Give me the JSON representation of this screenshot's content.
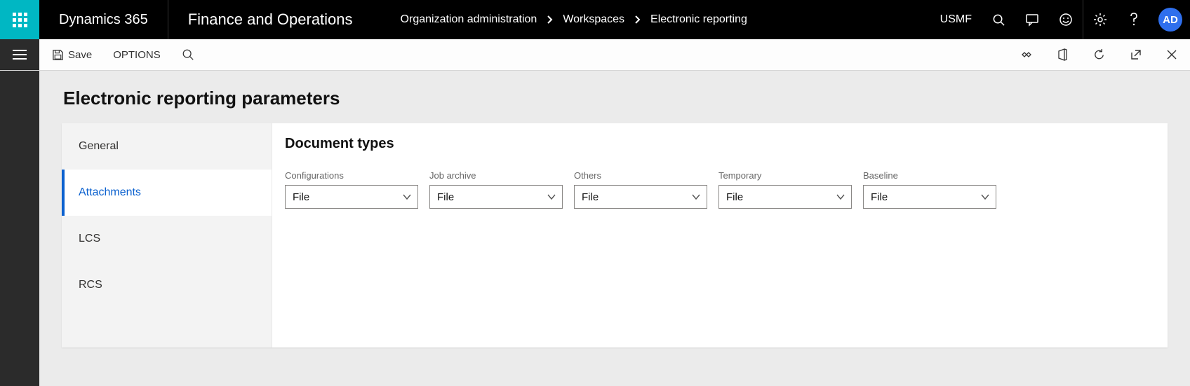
{
  "topbar": {
    "brand": "Dynamics 365",
    "module": "Finance and Operations",
    "company": "USMF",
    "avatar_initials": "AD"
  },
  "breadcrumbs": [
    "Organization administration",
    "Workspaces",
    "Electronic reporting"
  ],
  "actionbar": {
    "save_label": "Save",
    "options_label": "OPTIONS"
  },
  "page": {
    "title": "Electronic reporting parameters"
  },
  "tabs": [
    {
      "label": "General"
    },
    {
      "label": "Attachments"
    },
    {
      "label": "LCS"
    },
    {
      "label": "RCS"
    }
  ],
  "active_tab_index": 1,
  "section": {
    "title": "Document types",
    "fields": [
      {
        "label": "Configurations",
        "value": "File"
      },
      {
        "label": "Job archive",
        "value": "File"
      },
      {
        "label": "Others",
        "value": "File"
      },
      {
        "label": "Temporary",
        "value": "File"
      },
      {
        "label": "Baseline",
        "value": "File"
      }
    ]
  }
}
